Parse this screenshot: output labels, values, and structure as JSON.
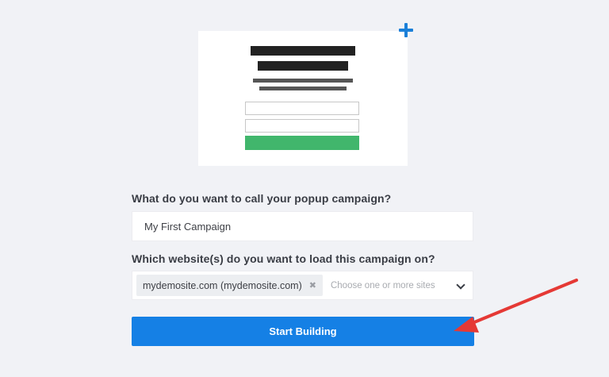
{
  "preview": {
    "plus_icon": "plus-icon",
    "bar_color": "#222222",
    "button_color": "#41b66c"
  },
  "form": {
    "name_label": "What do you want to call your popup campaign?",
    "name_value": "My First Campaign",
    "site_label": "Which website(s) do you want to load this campaign on?",
    "site_tag": "mydemosite.com (mydemosite.com)",
    "site_tag_remove": "✖",
    "site_placeholder": "Choose one or more sites",
    "submit_label": "Start Building"
  },
  "colors": {
    "accent": "#1580e5",
    "plus": "#1a7fd8",
    "annotation_arrow": "#e53935",
    "background": "#f1f2f6"
  }
}
